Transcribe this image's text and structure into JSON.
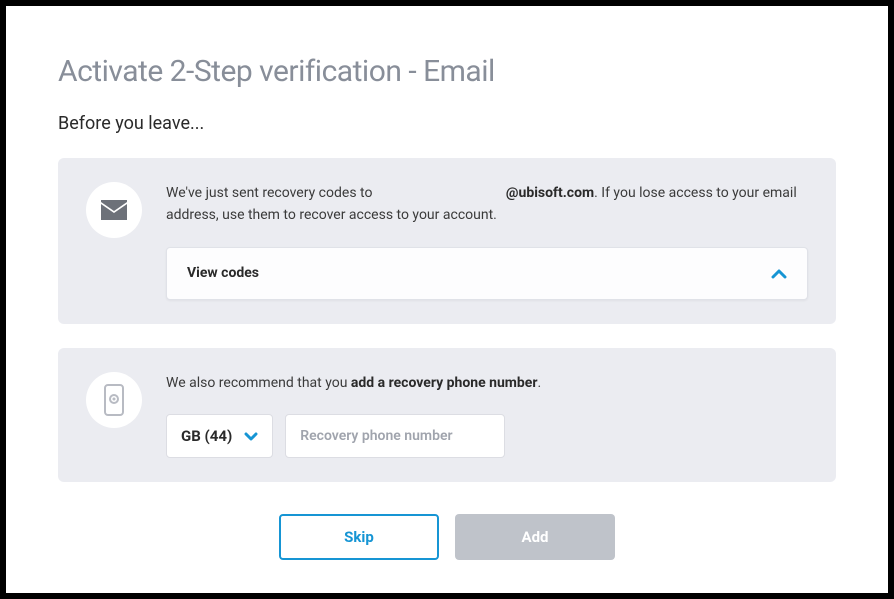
{
  "title": "Activate 2-Step verification - Email",
  "subtitle": "Before you leave...",
  "email_panel": {
    "text_prefix": "We've just sent recovery codes to ",
    "email_domain": "@ubisoft.com",
    "text_suffix": ". If you lose access to your email address, use them to recover access to your account.",
    "view_codes_label": "View codes"
  },
  "phone_panel": {
    "text_prefix": "We also recommend that you ",
    "text_bold": "add a recovery phone number",
    "text_suffix": ".",
    "country_code": "GB (44)",
    "phone_placeholder": "Recovery phone number"
  },
  "buttons": {
    "skip": "Skip",
    "add": "Add"
  }
}
